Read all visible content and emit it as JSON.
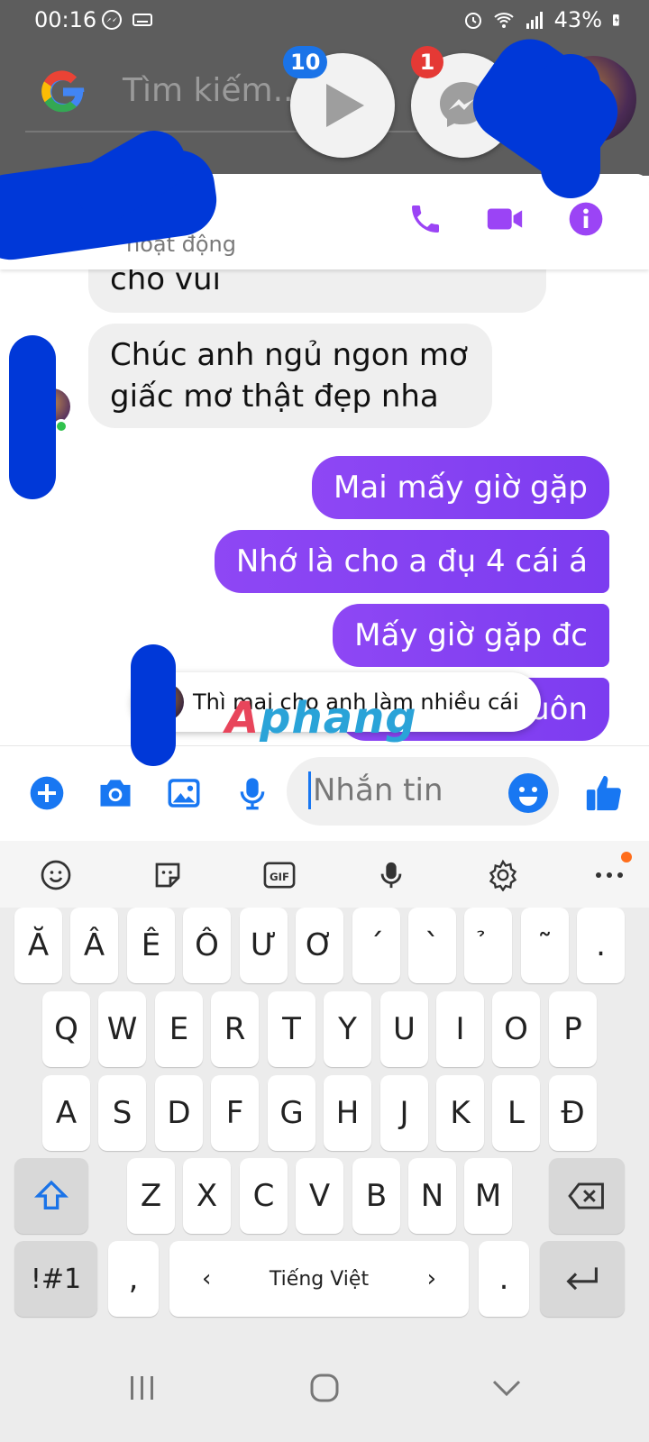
{
  "status_bar": {
    "time": "00:16",
    "battery": "43%"
  },
  "launcher": {
    "search_placeholder": "Tìm kiếm...",
    "chat_heads": [
      {
        "app": "video",
        "badge": "10"
      },
      {
        "app": "messenger",
        "badge": "1"
      }
    ]
  },
  "chat": {
    "header": {
      "status": "hoạt động"
    },
    "messages": [
      {
        "direction": "in",
        "text": "cho vui"
      },
      {
        "direction": "in",
        "text": "Chúc anh ngủ ngon mơ giấc mơ thật đẹp nha"
      },
      {
        "direction": "out",
        "text": "Mai mấy giờ gặp"
      },
      {
        "direction": "out",
        "text": "Nhớ là cho a đụ 4 cái á"
      },
      {
        "direction": "out",
        "text": "Mấy giờ gặp đc"
      },
      {
        "direction": "out",
        "text": "luôn"
      }
    ],
    "toast": "Thì mai cho anh làm nhiều cái",
    "watermark": {
      "part1": "A",
      "part2": "phang"
    },
    "composer": {
      "placeholder": "Nhắn tin"
    }
  },
  "keyboard": {
    "row1": [
      "Ă",
      "Â",
      "Ê",
      "Ô",
      "Ư",
      "Ơ",
      "´",
      "`",
      "̉",
      "˜",
      "."
    ],
    "row2": [
      "Q",
      "W",
      "E",
      "R",
      "T",
      "Y",
      "U",
      "I",
      "O",
      "P"
    ],
    "row3": [
      "A",
      "S",
      "D",
      "F",
      "G",
      "H",
      "J",
      "K",
      "L",
      "Đ"
    ],
    "row4": [
      "Z",
      "X",
      "C",
      "V",
      "B",
      "N",
      "M"
    ],
    "symbols_key": "!#1",
    "comma_key": ",",
    "space_label": "Tiếng Việt",
    "period_key": "."
  },
  "colors": {
    "accent": "#8b3ff5",
    "messenger_blue": "#1877f2",
    "redaction": "#0038d8"
  }
}
